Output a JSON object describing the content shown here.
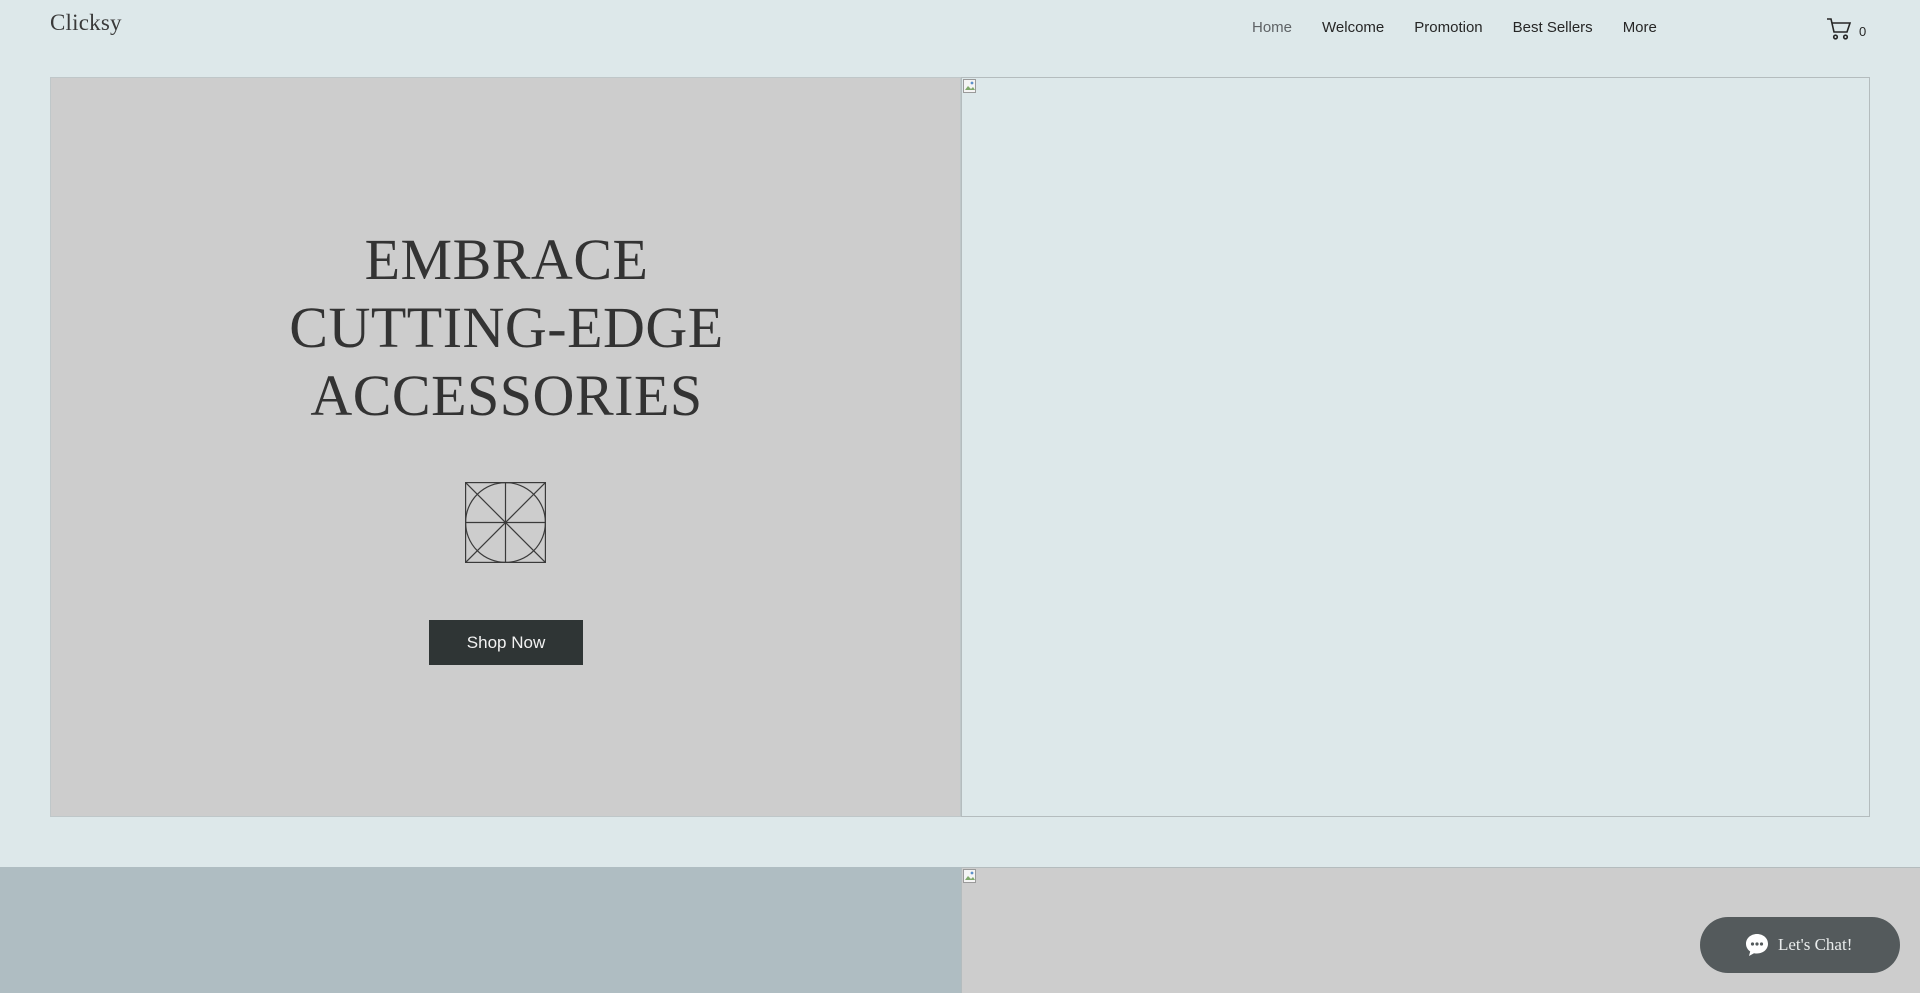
{
  "header": {
    "logo": "Clicksy",
    "nav": [
      {
        "label": "Home",
        "active": true
      },
      {
        "label": "Welcome",
        "active": false
      },
      {
        "label": "Promotion",
        "active": false
      },
      {
        "label": "Best Sellers",
        "active": false
      },
      {
        "label": "More",
        "active": false
      }
    ],
    "cart": {
      "icon": "cart-icon",
      "count": "0"
    }
  },
  "hero": {
    "headline_lines": [
      "EMBRACE",
      "CUTTING-EDGE",
      "ACCESSORIES"
    ],
    "emblem_icon": "geometric-emblem-icon",
    "cta_label": "Shop Now",
    "image_icon": "broken-image-icon"
  },
  "section2": {
    "image_icon": "broken-image-icon"
  },
  "chat": {
    "icon": "chat-bubble-icon",
    "label": "Let's Chat!"
  },
  "colors": {
    "page_bg": "#dde8ea",
    "hero_left_bg": "#cdcdcd",
    "button_bg": "#2f3535",
    "section2_left_bg": "#afbdc2",
    "chat_bg": "#545a5c"
  }
}
